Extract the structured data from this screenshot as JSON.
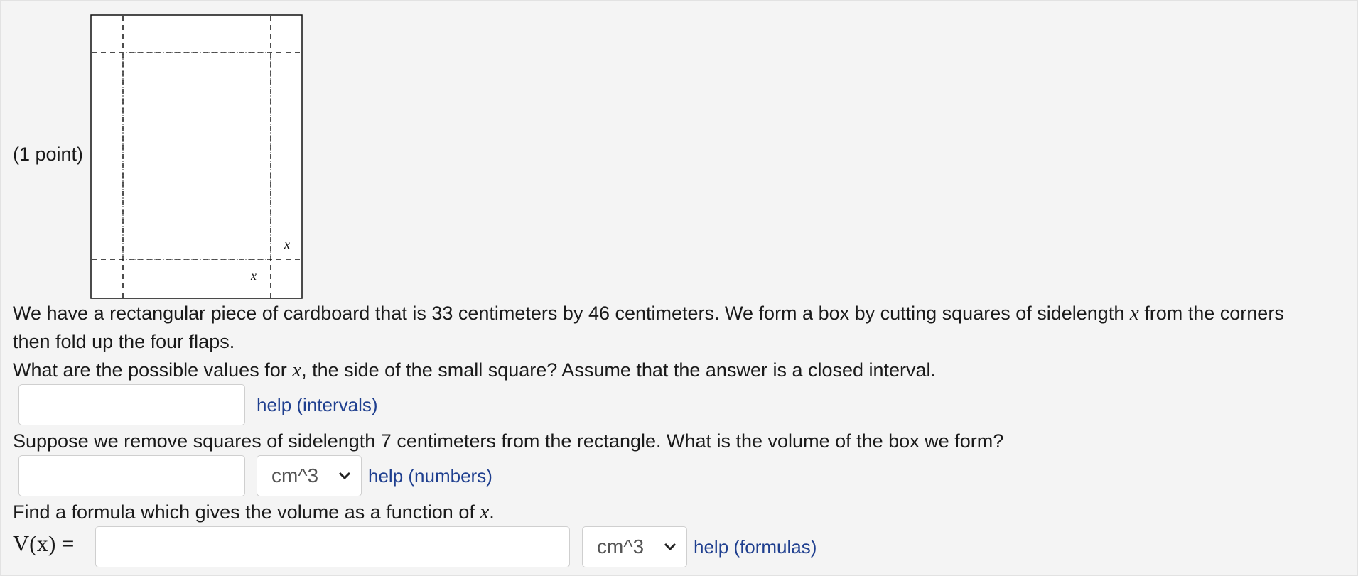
{
  "problem": {
    "points": "(1 point)",
    "figure": {
      "x_label_right": "x",
      "x_label_bottom": "x"
    },
    "intro_line1_a": "We have a rectangular piece of cardboard that is 33 centimeters by 46 centimeters. We form a box by cutting squares of sidelength",
    "intro_var": "x",
    "intro_line1_b": "from the corners",
    "intro_line2": "then fold up the four flaps."
  },
  "part1": {
    "question_a": "What are the possible values for",
    "question_var": "x",
    "question_b": ", the side of the small square? Assume that the answer is a closed interval.",
    "answer_value": "",
    "help_label": "help (intervals)"
  },
  "part2": {
    "question": "Suppose we remove squares of sidelength 7 centimeters from the rectangle. What is the volume of the box we form?",
    "answer_value": "",
    "unit_selected": "cm^3",
    "help_label": "help (numbers)"
  },
  "part3": {
    "question_a": "Find a formula which gives the volume as a function of",
    "question_var": "x",
    "question_b": ".",
    "label": "V(x) =",
    "answer_value": "",
    "unit_selected": "cm^3",
    "help_label": "help (formulas)"
  },
  "icons": {
    "dropdown": "chevron-down-icon"
  }
}
